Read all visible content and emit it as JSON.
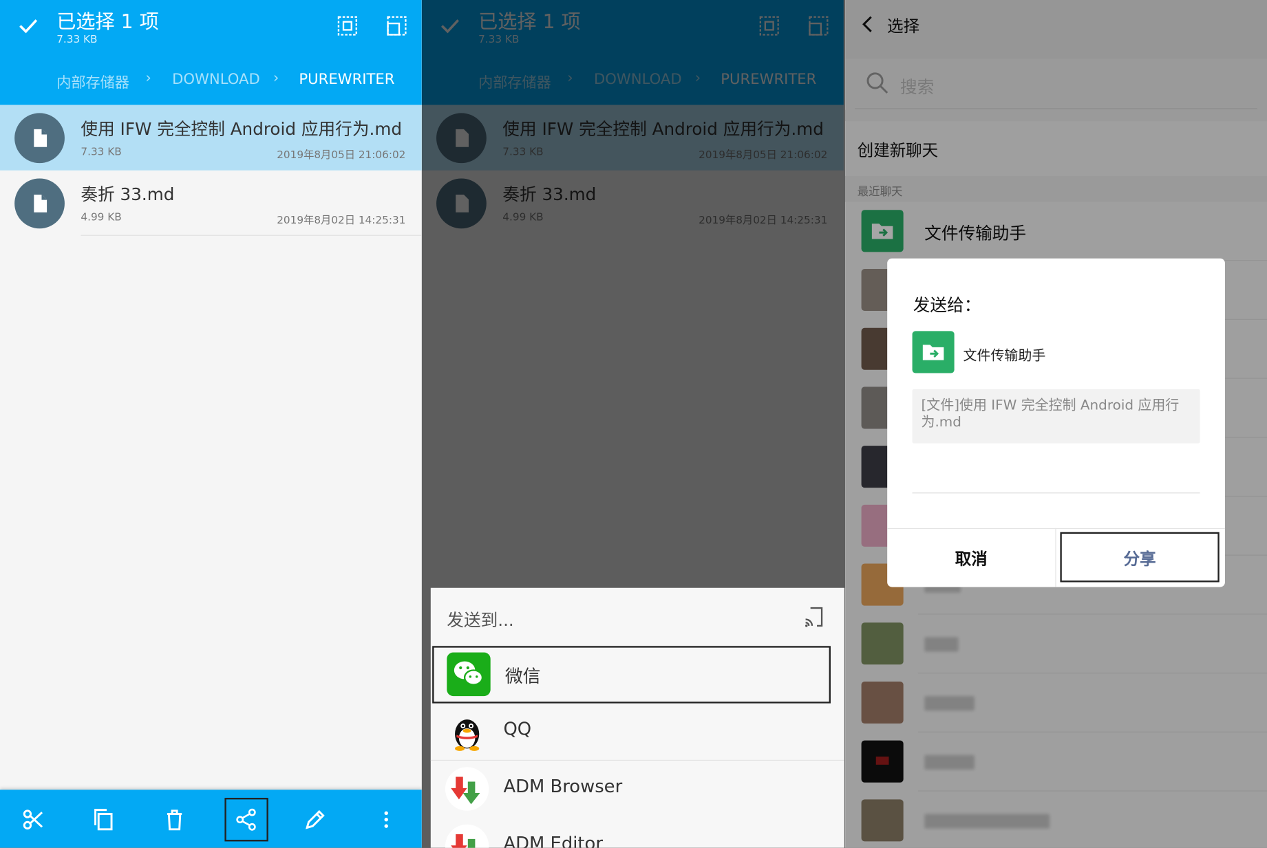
{
  "file_manager": {
    "title": "已选择 1 项",
    "selected_size": "7.33 KB",
    "breadcrumb": [
      "内部存储器",
      "DOWNLOAD",
      "PUREWRITER"
    ],
    "files": [
      {
        "name": "使用 IFW 完全控制 Android 应用行为.md",
        "size": "7.33 KB",
        "date": "2019年8月05日 21:06:02",
        "selected": true
      },
      {
        "name": "奏折 33.md",
        "size": "4.99 KB",
        "date": "2019年8月02日 14:25:31",
        "selected": false
      }
    ],
    "toolbar_icons": [
      "cut-icon",
      "copy-icon",
      "delete-icon",
      "share-icon",
      "rename-icon",
      "more-icon"
    ],
    "header_icons": [
      "check-icon",
      "select-all-icon",
      "select-inverse-icon"
    ],
    "accent_color": "#03a9f4"
  },
  "share_sheet": {
    "title": "发送到...",
    "apps": [
      {
        "label": "微信",
        "icon": "wechat-icon",
        "color": "#1aad19"
      },
      {
        "label": "QQ",
        "icon": "qq-penguin-icon",
        "color": "#000000"
      },
      {
        "label": "ADM Browser",
        "icon": "adm-download-icon",
        "color": "#43a047"
      },
      {
        "label": "ADM Editor",
        "icon": "adm-download-icon",
        "color": "#43a047"
      }
    ]
  },
  "wechat": {
    "title": "选择",
    "search_placeholder": "搜索",
    "new_chat": "创建新聊天",
    "recent_section": "最近聊天",
    "first_contact": "文件传输助手",
    "file_helper_color": "#2aae67"
  },
  "dialog": {
    "title": "发送给：",
    "target": "文件传输助手",
    "message": "[文件]使用 IFW 完全控制 Android 应用行为.md",
    "cancel": "取消",
    "share": "分享",
    "share_color": "#576b95"
  }
}
